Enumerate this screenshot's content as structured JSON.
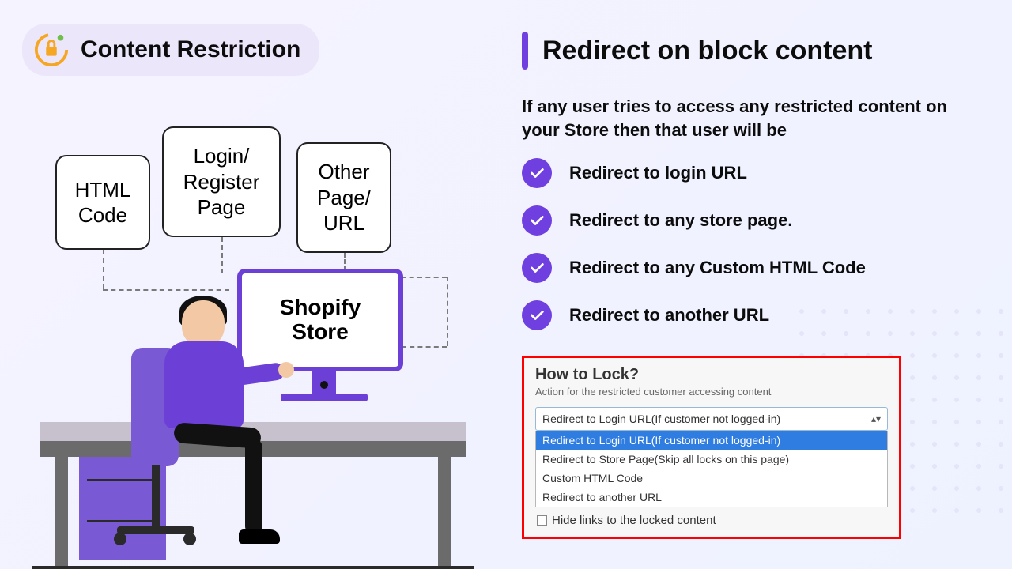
{
  "badge": {
    "label": "Content Restriction"
  },
  "diagram": {
    "card_a": "HTML\nCode",
    "card_b": "Login/\nRegister\nPage",
    "card_c": "Other\nPage/\nURL",
    "monitor": "Shopify\nStore"
  },
  "right": {
    "heading": "Redirect on block content",
    "description": "If any user tries to access any restricted content on your Store then that user will be",
    "bullets": [
      "Redirect to login URL",
      "Redirect to any store page.",
      "Redirect to any Custom HTML Code",
      "Redirect to another URL"
    ]
  },
  "panel": {
    "title": "How to Lock?",
    "subtitle": "Action for the restricted customer accessing content",
    "selected": "Redirect to Login URL(If customer not logged-in)",
    "options": [
      "Redirect to Login URL(If customer not logged-in)",
      "Redirect to Store Page(Skip all locks on this page)",
      "Custom HTML Code",
      "Redirect to another URL"
    ],
    "checkbox_label": "Hide links to the locked content"
  }
}
